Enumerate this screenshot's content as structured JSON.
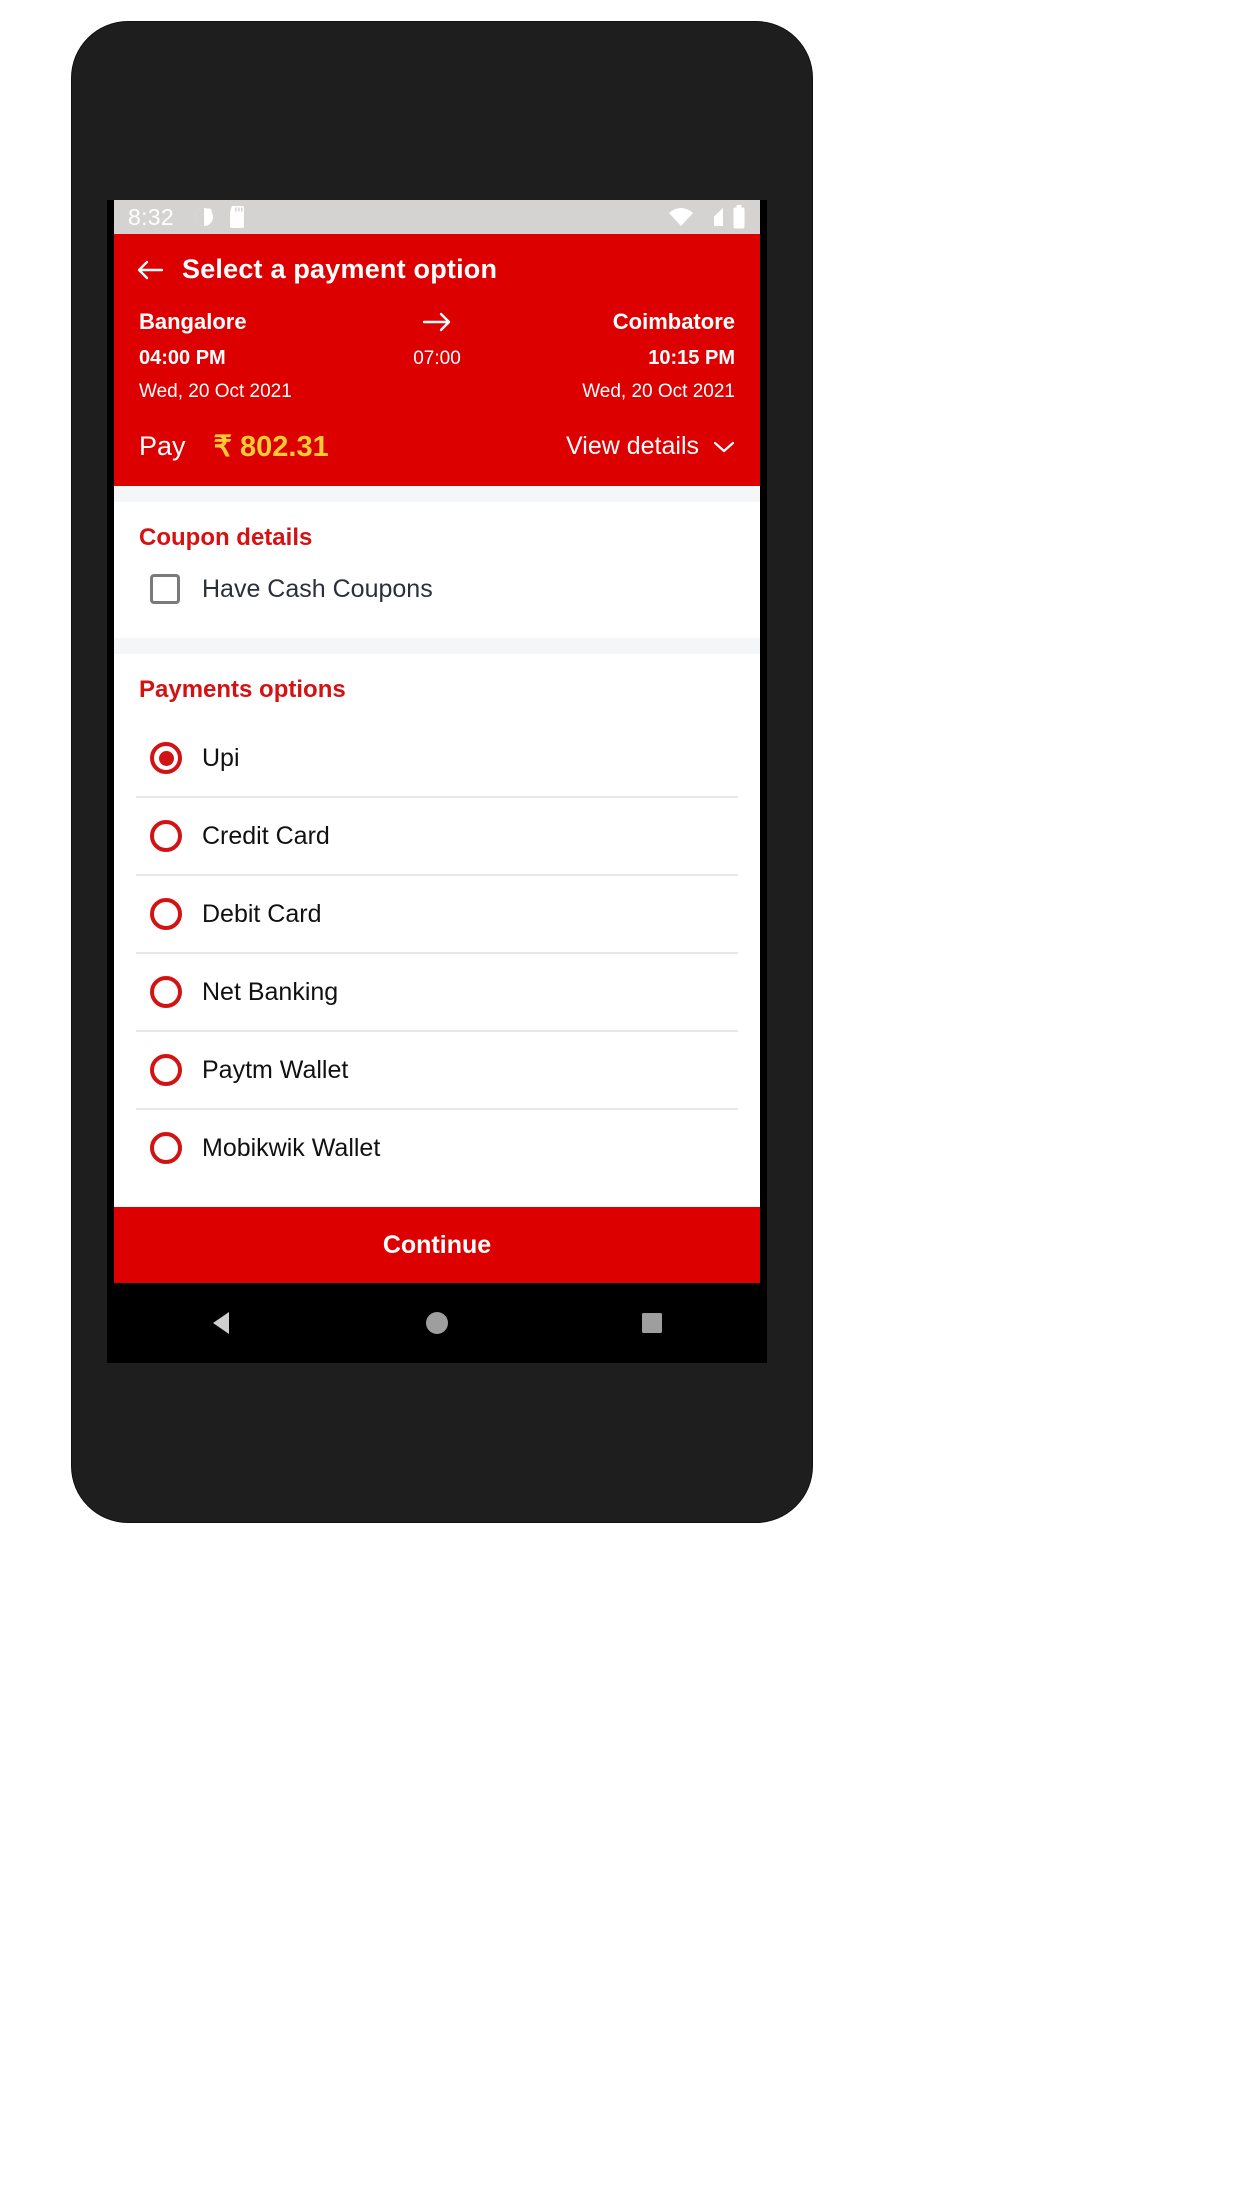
{
  "status_bar": {
    "time": "8:32",
    "left_icons": [
      "alarm-icon",
      "sd-card-icon"
    ],
    "right_icons": [
      "wifi-icon",
      "signal-icon",
      "battery-icon"
    ],
    "background": "#d5d3d2"
  },
  "app_bar": {
    "back_icon": "back-arrow-icon",
    "title": "Select a payment option",
    "background": "#dd0000"
  },
  "journey": {
    "origin": {
      "city": "Bangalore",
      "time": "04:00 PM",
      "date": "Wed, 20 Oct 2021"
    },
    "destination": {
      "city": "Coimbatore",
      "time": "10:15 PM",
      "date": "Wed, 20 Oct 2021"
    },
    "duration": "07:00",
    "arrow_icon": "arrow-right-icon"
  },
  "fare": {
    "pay_label": "Pay",
    "amount": "₹ 802.31",
    "amount_color": "#ffcc33",
    "view_details_label": "View details",
    "view_details_icon": "chevron-down-icon"
  },
  "coupon_section": {
    "title": "Coupon details",
    "checkbox_label": "Have Cash Coupons",
    "checked": false
  },
  "payments_section": {
    "title": "Payments options",
    "options": [
      {
        "label": "Upi",
        "selected": true
      },
      {
        "label": "Credit Card",
        "selected": false
      },
      {
        "label": "Debit Card",
        "selected": false
      },
      {
        "label": "Net Banking",
        "selected": false
      },
      {
        "label": "Paytm Wallet",
        "selected": false
      },
      {
        "label": "Mobikwik Wallet",
        "selected": false
      }
    ]
  },
  "continue_button": {
    "label": "Continue",
    "background": "#dd0000"
  },
  "nav_bar": {
    "back_icon": "nav-back-triangle-icon",
    "home_icon": "nav-home-circle-icon",
    "recents_icon": "nav-recents-square-icon"
  },
  "theme": {
    "primary_red": "#dd0000",
    "title_red": "#d31313",
    "accent_yellow": "#ffcc33"
  }
}
